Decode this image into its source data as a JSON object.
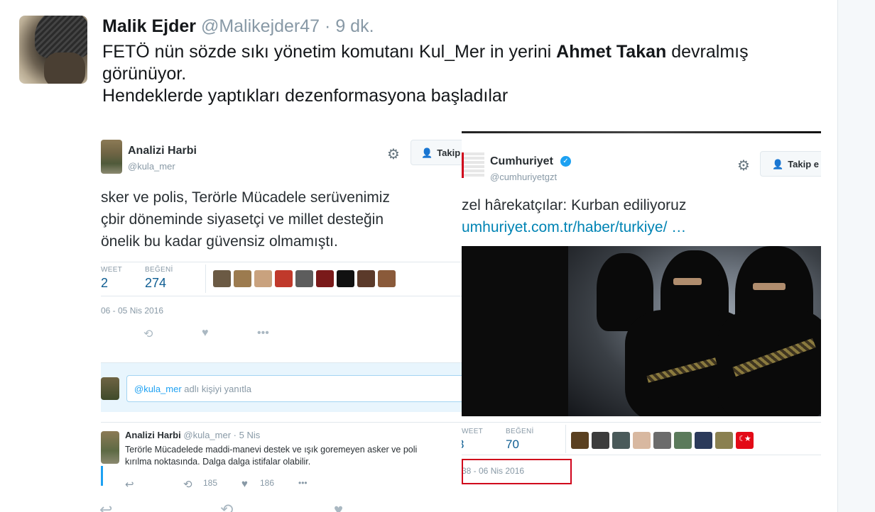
{
  "tweet": {
    "name": "Malik Ejder",
    "handle": "@Malikejder47",
    "separator": "·",
    "time": "9 dk.",
    "text_line1_part1": "FETÖ nün sözde sıkı yönetim komutanı Kul_Mer in yerini ",
    "text_line1_bold": "Ahmet Takan",
    "text_line1_part2": " devralmış",
    "text_line2": "görünüyor.",
    "text_line3": "Hendeklerde yaptıkları dezenformasyona başladılar"
  },
  "embed_left": {
    "name": "Analizi Harbi",
    "handle": "@kula_mer",
    "follow_label": "Takip",
    "text_lines": [
      "sker ve polis, Terörle Mücadele serüvenimiz",
      "çbir döneminde siyasetçi ve millet desteğin",
      "önelik bu kadar güvensiz olmamıştı."
    ],
    "retweets_label": "WEET",
    "retweets_value": "2",
    "likes_label": "BEĞENİ",
    "likes_value": "274",
    "date": "06 - 05 Nis 2016",
    "reply_mention": "@kula_mer",
    "reply_placeholder": " adlı kişiyi yanıtla",
    "sub_tweet": {
      "name": "Analizi Harbi",
      "handle": "@kula_mer",
      "time": "· 5 Nis",
      "text_line1": "Terörle Mücadelede maddi-manevi destek ve ışık goremeyen asker ve poli",
      "text_line2": "kırılma noktasında. Dalga dalga istifalar olabilir.",
      "retweet_count": "185",
      "like_count": "186"
    }
  },
  "embed_right": {
    "name": "Cumhuriyet",
    "handle": "@cumhuriyetgzt",
    "follow_label": "Takip e",
    "text": "zel hârekatçılar: Kurban ediliyoruz",
    "link": "umhuriyet.com.tr/haber/turkiye/  …",
    "retweets_label": "WEET",
    "retweets_value": "3",
    "likes_label": "BEĞENİ",
    "likes_value": "70",
    "date": "38 - 06 Nis 2016"
  },
  "icons": {
    "gear": "⚙",
    "follow": "person-plus-icon",
    "retweet": "⟲",
    "like": "♥",
    "more": "•••",
    "reply": "↩",
    "verified": "✓"
  },
  "colors": {
    "link_blue": "#1da1f2",
    "stat_blue": "#0e5d92",
    "highlight_red": "#d0021b"
  }
}
